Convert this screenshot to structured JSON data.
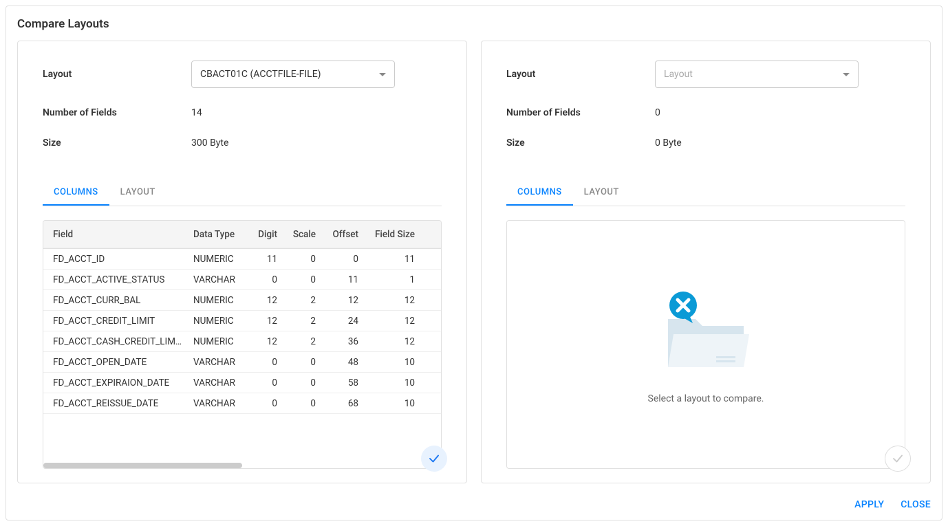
{
  "title": "Compare Layouts",
  "labels": {
    "layout": "Layout",
    "numFields": "Number of Fields",
    "size": "Size"
  },
  "tabs": {
    "columns": "COLUMNS",
    "layout": "LAYOUT"
  },
  "columns": {
    "field": "Field",
    "dataType": "Data Type",
    "digit": "Digit",
    "scale": "Scale",
    "offset": "Offset",
    "fieldSize": "Field Size"
  },
  "left": {
    "layoutSelected": "CBACT01C (ACCTFILE-FILE)",
    "numFields": "14",
    "size": "300 Byte",
    "rows": [
      {
        "field": "FD_ACCT_ID",
        "type": "NUMERIC",
        "digit": "11",
        "scale": "0",
        "offset": "0",
        "size": "11"
      },
      {
        "field": "FD_ACCT_ACTIVE_STATUS",
        "type": "VARCHAR",
        "digit": "0",
        "scale": "0",
        "offset": "11",
        "size": "1"
      },
      {
        "field": "FD_ACCT_CURR_BAL",
        "type": "NUMERIC",
        "digit": "12",
        "scale": "2",
        "offset": "12",
        "size": "12"
      },
      {
        "field": "FD_ACCT_CREDIT_LIMIT",
        "type": "NUMERIC",
        "digit": "12",
        "scale": "2",
        "offset": "24",
        "size": "12"
      },
      {
        "field": "FD_ACCT_CASH_CREDIT_LIMIT",
        "type": "NUMERIC",
        "digit": "12",
        "scale": "2",
        "offset": "36",
        "size": "12"
      },
      {
        "field": "FD_ACCT_OPEN_DATE",
        "type": "VARCHAR",
        "digit": "0",
        "scale": "0",
        "offset": "48",
        "size": "10"
      },
      {
        "field": "FD_ACCT_EXPIRAION_DATE",
        "type": "VARCHAR",
        "digit": "0",
        "scale": "0",
        "offset": "58",
        "size": "10"
      },
      {
        "field": "FD_ACCT_REISSUE_DATE",
        "type": "VARCHAR",
        "digit": "0",
        "scale": "0",
        "offset": "68",
        "size": "10"
      }
    ]
  },
  "right": {
    "layoutPlaceholder": "Layout",
    "numFields": "0",
    "size": "0 Byte",
    "emptyMsg": "Select a layout to compare."
  },
  "buttons": {
    "apply": "APPLY",
    "close": "CLOSE"
  }
}
